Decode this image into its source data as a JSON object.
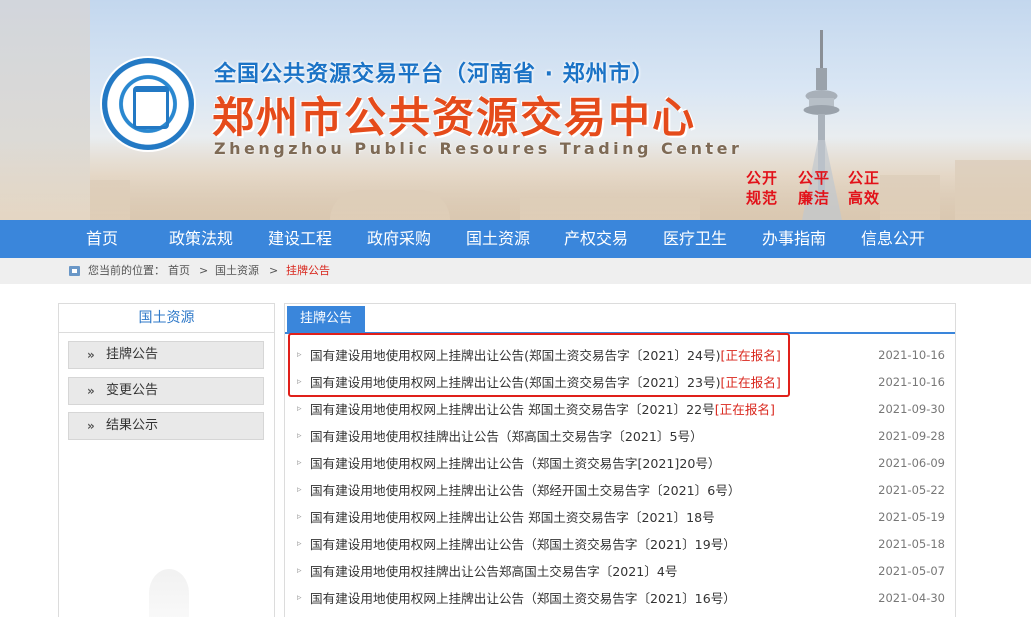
{
  "header": {
    "title_small": "全国公共资源交易平台（河南省 · 郑州市）",
    "title_big": "郑州市公共资源交易中心",
    "title_en": "Zhengzhou Public Resoures Trading Center",
    "slogans": [
      "公开",
      "公平",
      "公正",
      "规范",
      "廉洁",
      "高效"
    ]
  },
  "nav": {
    "items": [
      "首页",
      "政策法规",
      "建设工程",
      "政府采购",
      "国土资源",
      "产权交易",
      "医疗卫生",
      "办事指南",
      "信息公开"
    ]
  },
  "breadcrumb": {
    "prefix": "您当前的位置：",
    "items": [
      "首页",
      "国土资源",
      "挂牌公告"
    ],
    "separator": ">"
  },
  "sidebar": {
    "title": "国土资源",
    "items": [
      "挂牌公告",
      "变更公告",
      "结果公示"
    ]
  },
  "main": {
    "tab": "挂牌公告",
    "rows": [
      {
        "title": "国有建设用地使用权网上挂牌出让公告(郑国土资交易告字〔2021〕24号)",
        "status": "[正在报名]",
        "date": "2021-10-16"
      },
      {
        "title": "国有建设用地使用权网上挂牌出让公告(郑国土资交易告字〔2021〕23号)",
        "status": "[正在报名]",
        "date": "2021-10-16"
      },
      {
        "title": "国有建设用地使用权网上挂牌出让公告 郑国土资交易告字〔2021〕22号",
        "status": "[正在报名]",
        "date": "2021-09-30"
      },
      {
        "title": "国有建设用地使用权挂牌出让公告（郑高国土交易告字〔2021〕5号）",
        "status": "",
        "date": "2021-09-28"
      },
      {
        "title": "国有建设用地使用权网上挂牌出让公告（郑国土资交易告字[2021]20号）",
        "status": "",
        "date": "2021-06-09"
      },
      {
        "title": "国有建设用地使用权网上挂牌出让公告（郑经开国土交易告字〔2021〕6号）",
        "status": "",
        "date": "2021-05-22"
      },
      {
        "title": "国有建设用地使用权网上挂牌出让公告 郑国土资交易告字〔2021〕18号",
        "status": "",
        "date": "2021-05-19"
      },
      {
        "title": "国有建设用地使用权网上挂牌出让公告（郑国土资交易告字〔2021〕19号）",
        "status": "",
        "date": "2021-05-18"
      },
      {
        "title": "国有建设用地使用权挂牌出让公告郑高国土交易告字〔2021〕4号",
        "status": "",
        "date": "2021-05-07"
      },
      {
        "title": "国有建设用地使用权网上挂牌出让公告（郑国土资交易告字〔2021〕16号）",
        "status": "",
        "date": "2021-04-30"
      }
    ]
  },
  "colors": {
    "nav_blue": "#3a86db",
    "title_red": "#e54b1b",
    "title_blue": "#1b73c6",
    "status_red": "#d9261c",
    "highlight_red": "#e0201a"
  }
}
